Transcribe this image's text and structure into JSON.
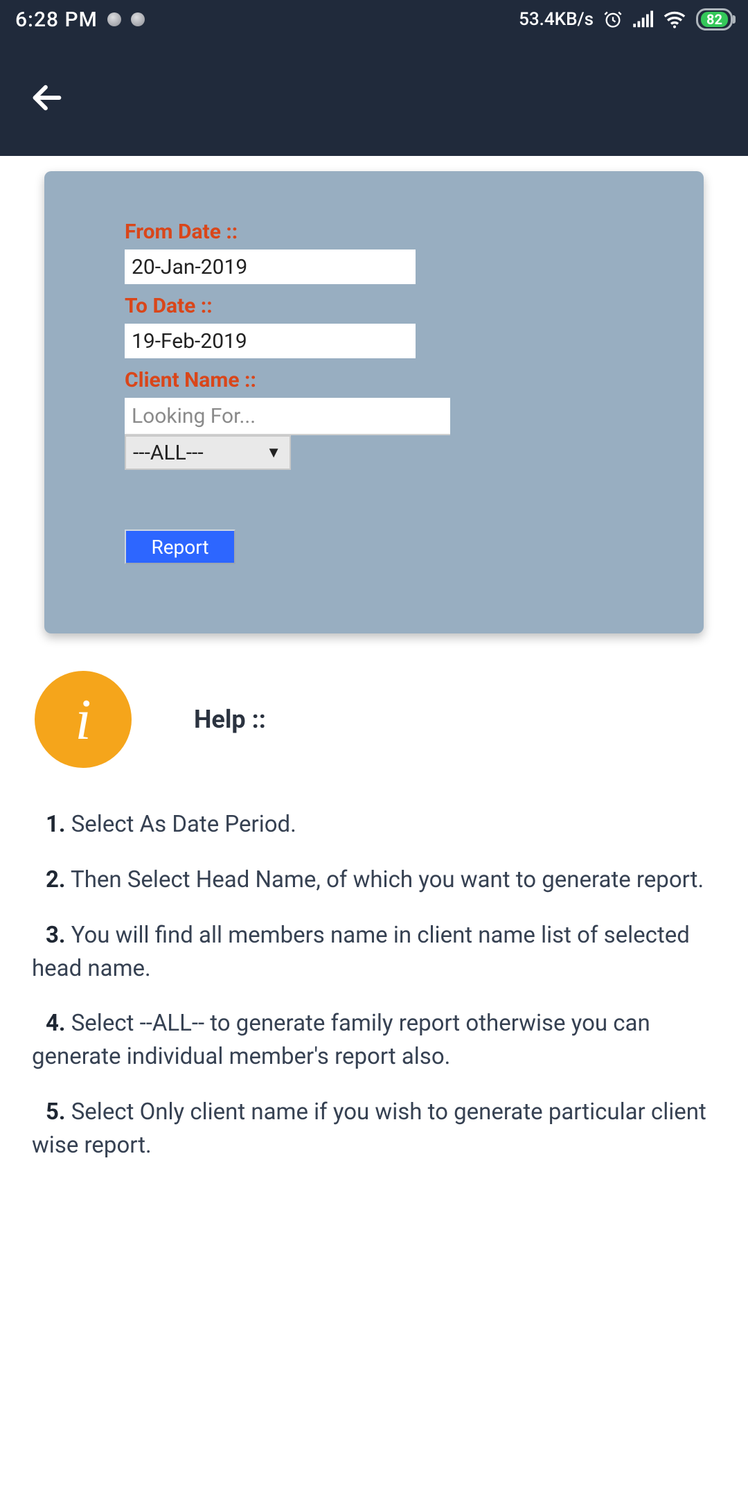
{
  "status_bar": {
    "time": "6:28 PM",
    "net_speed": "53.4KB/s",
    "battery_pct": "82"
  },
  "form": {
    "from_date_label": "From Date ::",
    "from_date_value": "20-Jan-2019",
    "to_date_label": "To Date ::",
    "to_date_value": "19-Feb-2019",
    "client_name_label": "Client Name ::",
    "search_placeholder": "Looking For...",
    "dropdown_selected": "---ALL---",
    "report_button": "Report"
  },
  "help": {
    "title": "Help ::",
    "items": [
      {
        "num": "1.",
        "text": " Select As Date Period."
      },
      {
        "num": "2.",
        "text": " Then Select Head Name, of which you want to generate report."
      },
      {
        "num": "3.",
        "text": " You will find all members name in client name list of selected head name."
      },
      {
        "num": "4.",
        "text": " Select --ALL-- to generate family report otherwise you can generate individual member's report also."
      },
      {
        "num": "5.",
        "text": " Select Only client name if you wish to generate particular client wise report."
      }
    ]
  }
}
